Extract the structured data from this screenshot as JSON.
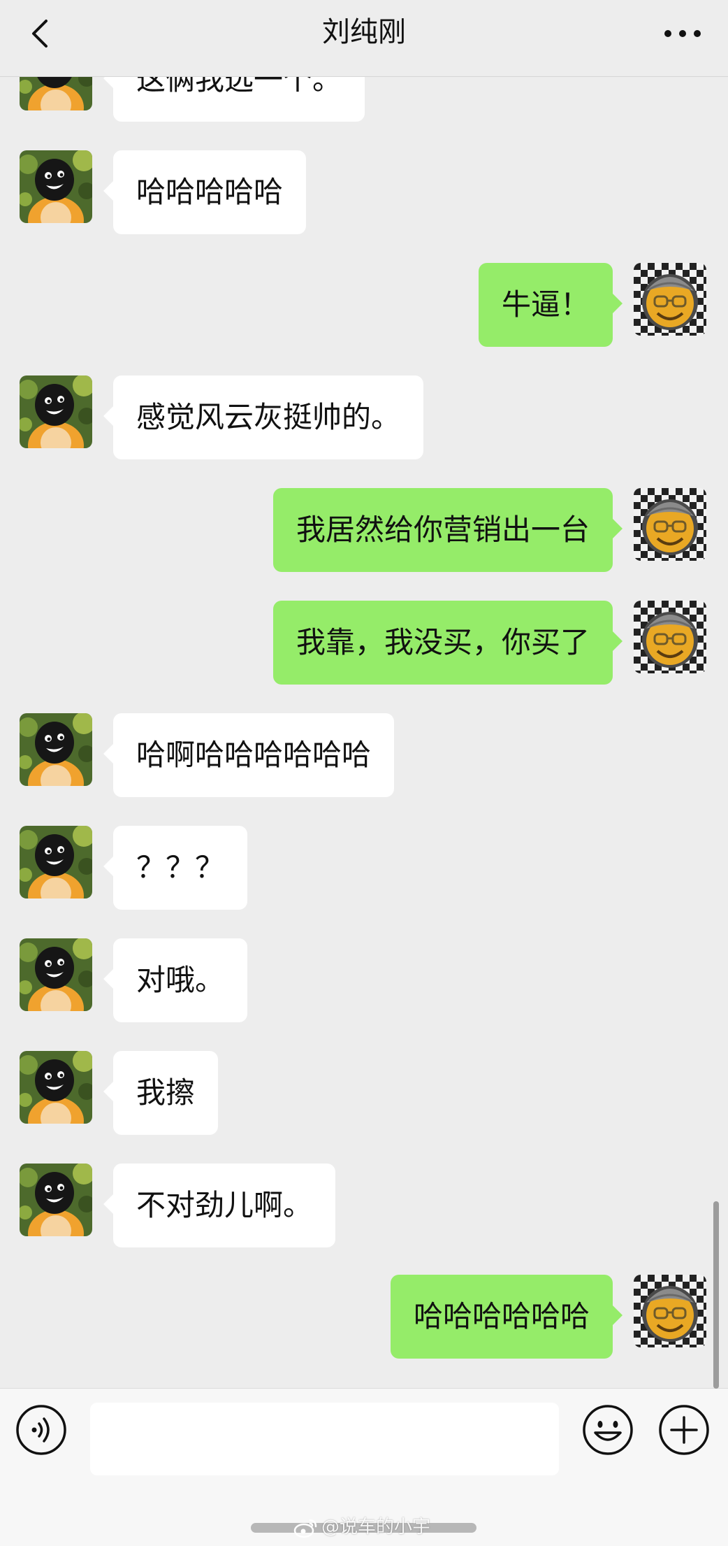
{
  "header": {
    "title": "刘纯刚",
    "back_icon": "chevron-left-icon",
    "more_icon": "more-dots-icon"
  },
  "messages": [
    {
      "side": "left",
      "text": "这俩我选一个。",
      "partial": true
    },
    {
      "side": "left",
      "text": "哈哈哈哈哈"
    },
    {
      "side": "right",
      "text": "牛逼！"
    },
    {
      "side": "left",
      "text": "感觉风云灰挺帅的。"
    },
    {
      "side": "right",
      "text": "我居然给你营销出一台"
    },
    {
      "side": "right",
      "text": "我靠，我没买，你买了"
    },
    {
      "side": "left",
      "text": "哈啊哈哈哈哈哈哈"
    },
    {
      "side": "left",
      "text": "？？？"
    },
    {
      "side": "left",
      "text": "对哦。"
    },
    {
      "side": "left",
      "text": "我擦"
    },
    {
      "side": "left",
      "text": "不对劲儿啊。"
    },
    {
      "side": "right",
      "text": "哈哈哈哈哈哈"
    }
  ],
  "input_bar": {
    "value": "",
    "voice_icon": "voice-icon",
    "emoji_icon": "emoji-icon",
    "plus_icon": "plus-icon"
  },
  "watermark": {
    "text": "@说车的小宇",
    "icon": "weibo-icon"
  },
  "colors": {
    "background": "#ededed",
    "bubble_self": "#95ec69",
    "bubble_other": "#ffffff",
    "text": "#111111"
  }
}
